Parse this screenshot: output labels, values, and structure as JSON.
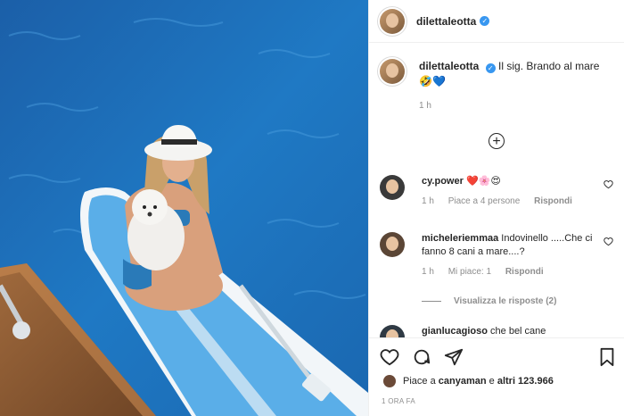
{
  "post": {
    "username": "dilettaleotta",
    "verified_mark": "✓",
    "caption": "Il sig. Brando al mare",
    "caption_emojis": [
      "🤣",
      "💙"
    ],
    "caption_time": "1 h",
    "comments": [
      {
        "username": "cy.power",
        "text": "❤️🌸😍",
        "time": "1 h",
        "likes": "Piace a 4 persone",
        "reply": "Rispondi"
      },
      {
        "username": "micheleriemmaa",
        "text": "Indovinello .....Che ci fanno 8 cani a mare....?",
        "time": "1 h",
        "likes": "Mi piace: 1",
        "reply": "Rispondi"
      },
      {
        "username": "gianlucagioso",
        "text": "che bel cane"
      }
    ],
    "view_replies": "Visualizza le risposte (2)",
    "likes_prefix": "Piace a ",
    "likes_user": "canyaman",
    "likes_middle": " e ",
    "likes_others": "altri 123.966",
    "post_time": "1 ORA FA"
  },
  "icons": [
    "heart-icon",
    "comment-icon",
    "share-icon",
    "bookmark-icon",
    "add-comment-icon",
    "verified-icon"
  ],
  "colors": {
    "verified": "#3897f0",
    "sea": "#1f6fb5",
    "board": "#5aa9e6"
  }
}
